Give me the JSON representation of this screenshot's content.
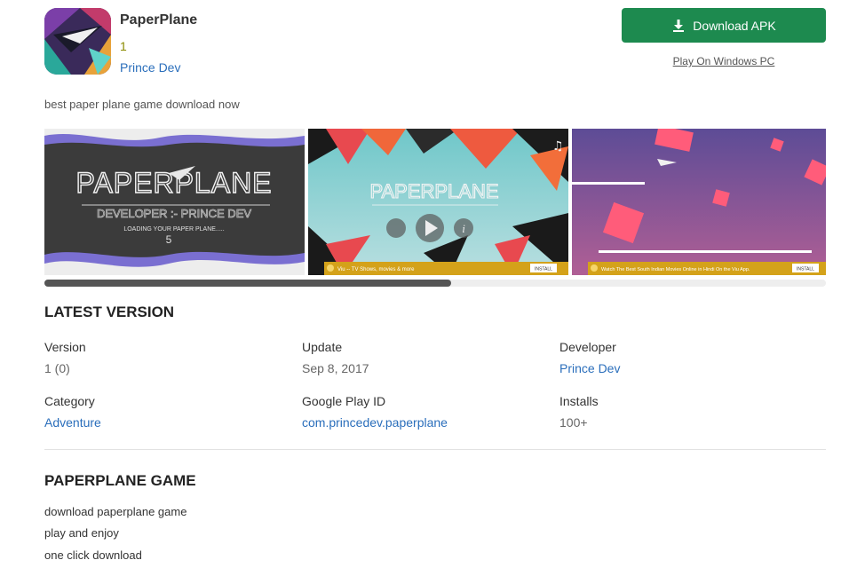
{
  "app": {
    "title": "PaperPlane",
    "version": "1",
    "developer": "Prince Dev",
    "tagline": "best paper plane game download now"
  },
  "actions": {
    "download_label": "Download APK",
    "pc_label": "Play On Windows PC"
  },
  "screenshots": {
    "shot1": {
      "title": "PAPERPLANE",
      "developer": "DEVELOPER :- PRINCE DEV",
      "loading": "LOADING YOUR PAPER PLANE.....",
      "count": "5"
    },
    "shot2": {
      "title": "PAPERPLANE",
      "ad_text": "Viu -- TV Shows, movies & more",
      "ad_button": "INSTALL"
    },
    "shot3": {
      "ad_text": "Watch The Best South Indian Movies Online in Hindi On the Viu App.",
      "ad_button": "INSTALL"
    },
    "scroll_fraction": 0.52
  },
  "latest": {
    "heading": "LATEST VERSION",
    "version_label": "Version",
    "version_value": "1 (0)",
    "update_label": "Update",
    "update_value": "Sep 8, 2017",
    "developer_label": "Developer",
    "developer_value": "Prince Dev",
    "category_label": "Category",
    "category_value": "Adventure",
    "playid_label": "Google Play ID",
    "playid_value": "com.princedev.paperplane",
    "installs_label": "Installs",
    "installs_value": "100+"
  },
  "game": {
    "heading": "PAPERPLANE GAME",
    "lines": [
      "download paperplane game",
      "play and enjoy",
      "one click download"
    ]
  },
  "colors": {
    "accent_green": "#1d8a4f",
    "link_blue": "#2a6ebb",
    "version_olive": "#8a8a00"
  }
}
